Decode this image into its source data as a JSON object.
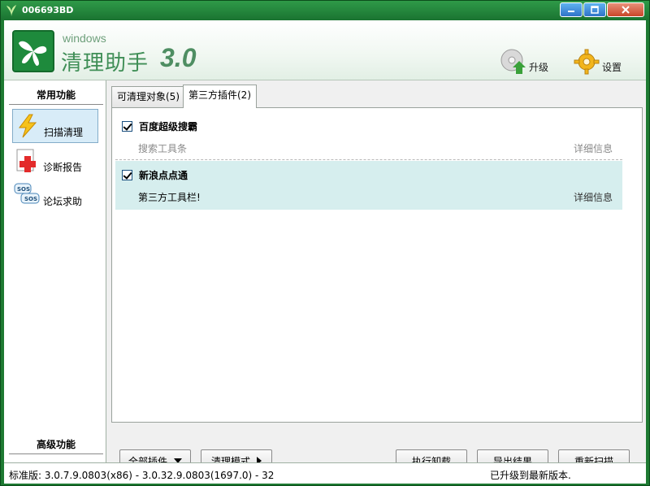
{
  "window": {
    "title": "006693BD",
    "minimize_glyph": "–",
    "maximize_glyph": "▣",
    "close_glyph": "✕"
  },
  "header": {
    "brand_small": "windows",
    "brand_name": "清理助手",
    "brand_version": "3.0",
    "upgrade_label": "升级",
    "settings_label": "设置"
  },
  "sidebar": {
    "common_title": "常用功能",
    "items": [
      {
        "label": "扫描清理",
        "icon": "lightning-icon",
        "active": true
      },
      {
        "label": "诊断报告",
        "icon": "medical-cross-icon",
        "active": false
      },
      {
        "label": "论坛求助",
        "icon": "sos-bubble-icon",
        "active": false
      }
    ],
    "advanced_title": "高级功能"
  },
  "tabs": [
    {
      "label": "可清理对象(5)",
      "active": false
    },
    {
      "label": "第三方插件(2)",
      "active": true
    }
  ],
  "plugins": [
    {
      "name": "百度超级搜霸",
      "checked": true,
      "description": "搜索工具条",
      "detail": "详细信息"
    },
    {
      "name": "新浪点点通",
      "checked": true,
      "description": "第三方工具栏!",
      "detail": "详细信息"
    }
  ],
  "buttons": {
    "all_plugins": "全部插件",
    "clean_mode": "清理模式",
    "uninstall": "执行卸载",
    "export": "导出结果",
    "rescan": "重新扫描"
  },
  "status": {
    "version_text": "标准版: 3.0.7.9.0803(x86) - 3.0.32.9.0803(1697.0) - 32",
    "update_text": "已升级到最新版本."
  },
  "colors": {
    "frame": "#1e7a32",
    "selected_row": "#d6eeee",
    "active_nav": "#d8ecf8"
  }
}
